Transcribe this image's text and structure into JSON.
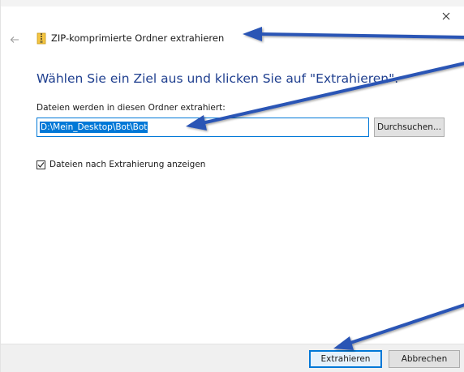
{
  "window": {
    "title": "ZIP-komprimierte Ordner extrahieren",
    "close_icon": "close-icon",
    "back_icon": "back-arrow-icon",
    "zip_icon": "zip-folder-icon"
  },
  "main": {
    "heading": "Wählen Sie ein Ziel aus und klicken Sie auf \"Extrahieren\".",
    "destination_label": "Dateien werden in diesen Ordner extrahiert:",
    "destination_value": "D:\\Mein_Desktop\\Bot\\Bot",
    "browse_label": "Durchsuchen...",
    "show_files_checkbox": {
      "label": "Dateien nach Extrahierung anzeigen",
      "checked": true
    }
  },
  "footer": {
    "extract_label": "Extrahieren",
    "cancel_label": "Abbrechen"
  },
  "colors": {
    "accent": "#0078d7",
    "heading": "#1f3f8f",
    "annotation_arrow": "#2a55b5"
  }
}
